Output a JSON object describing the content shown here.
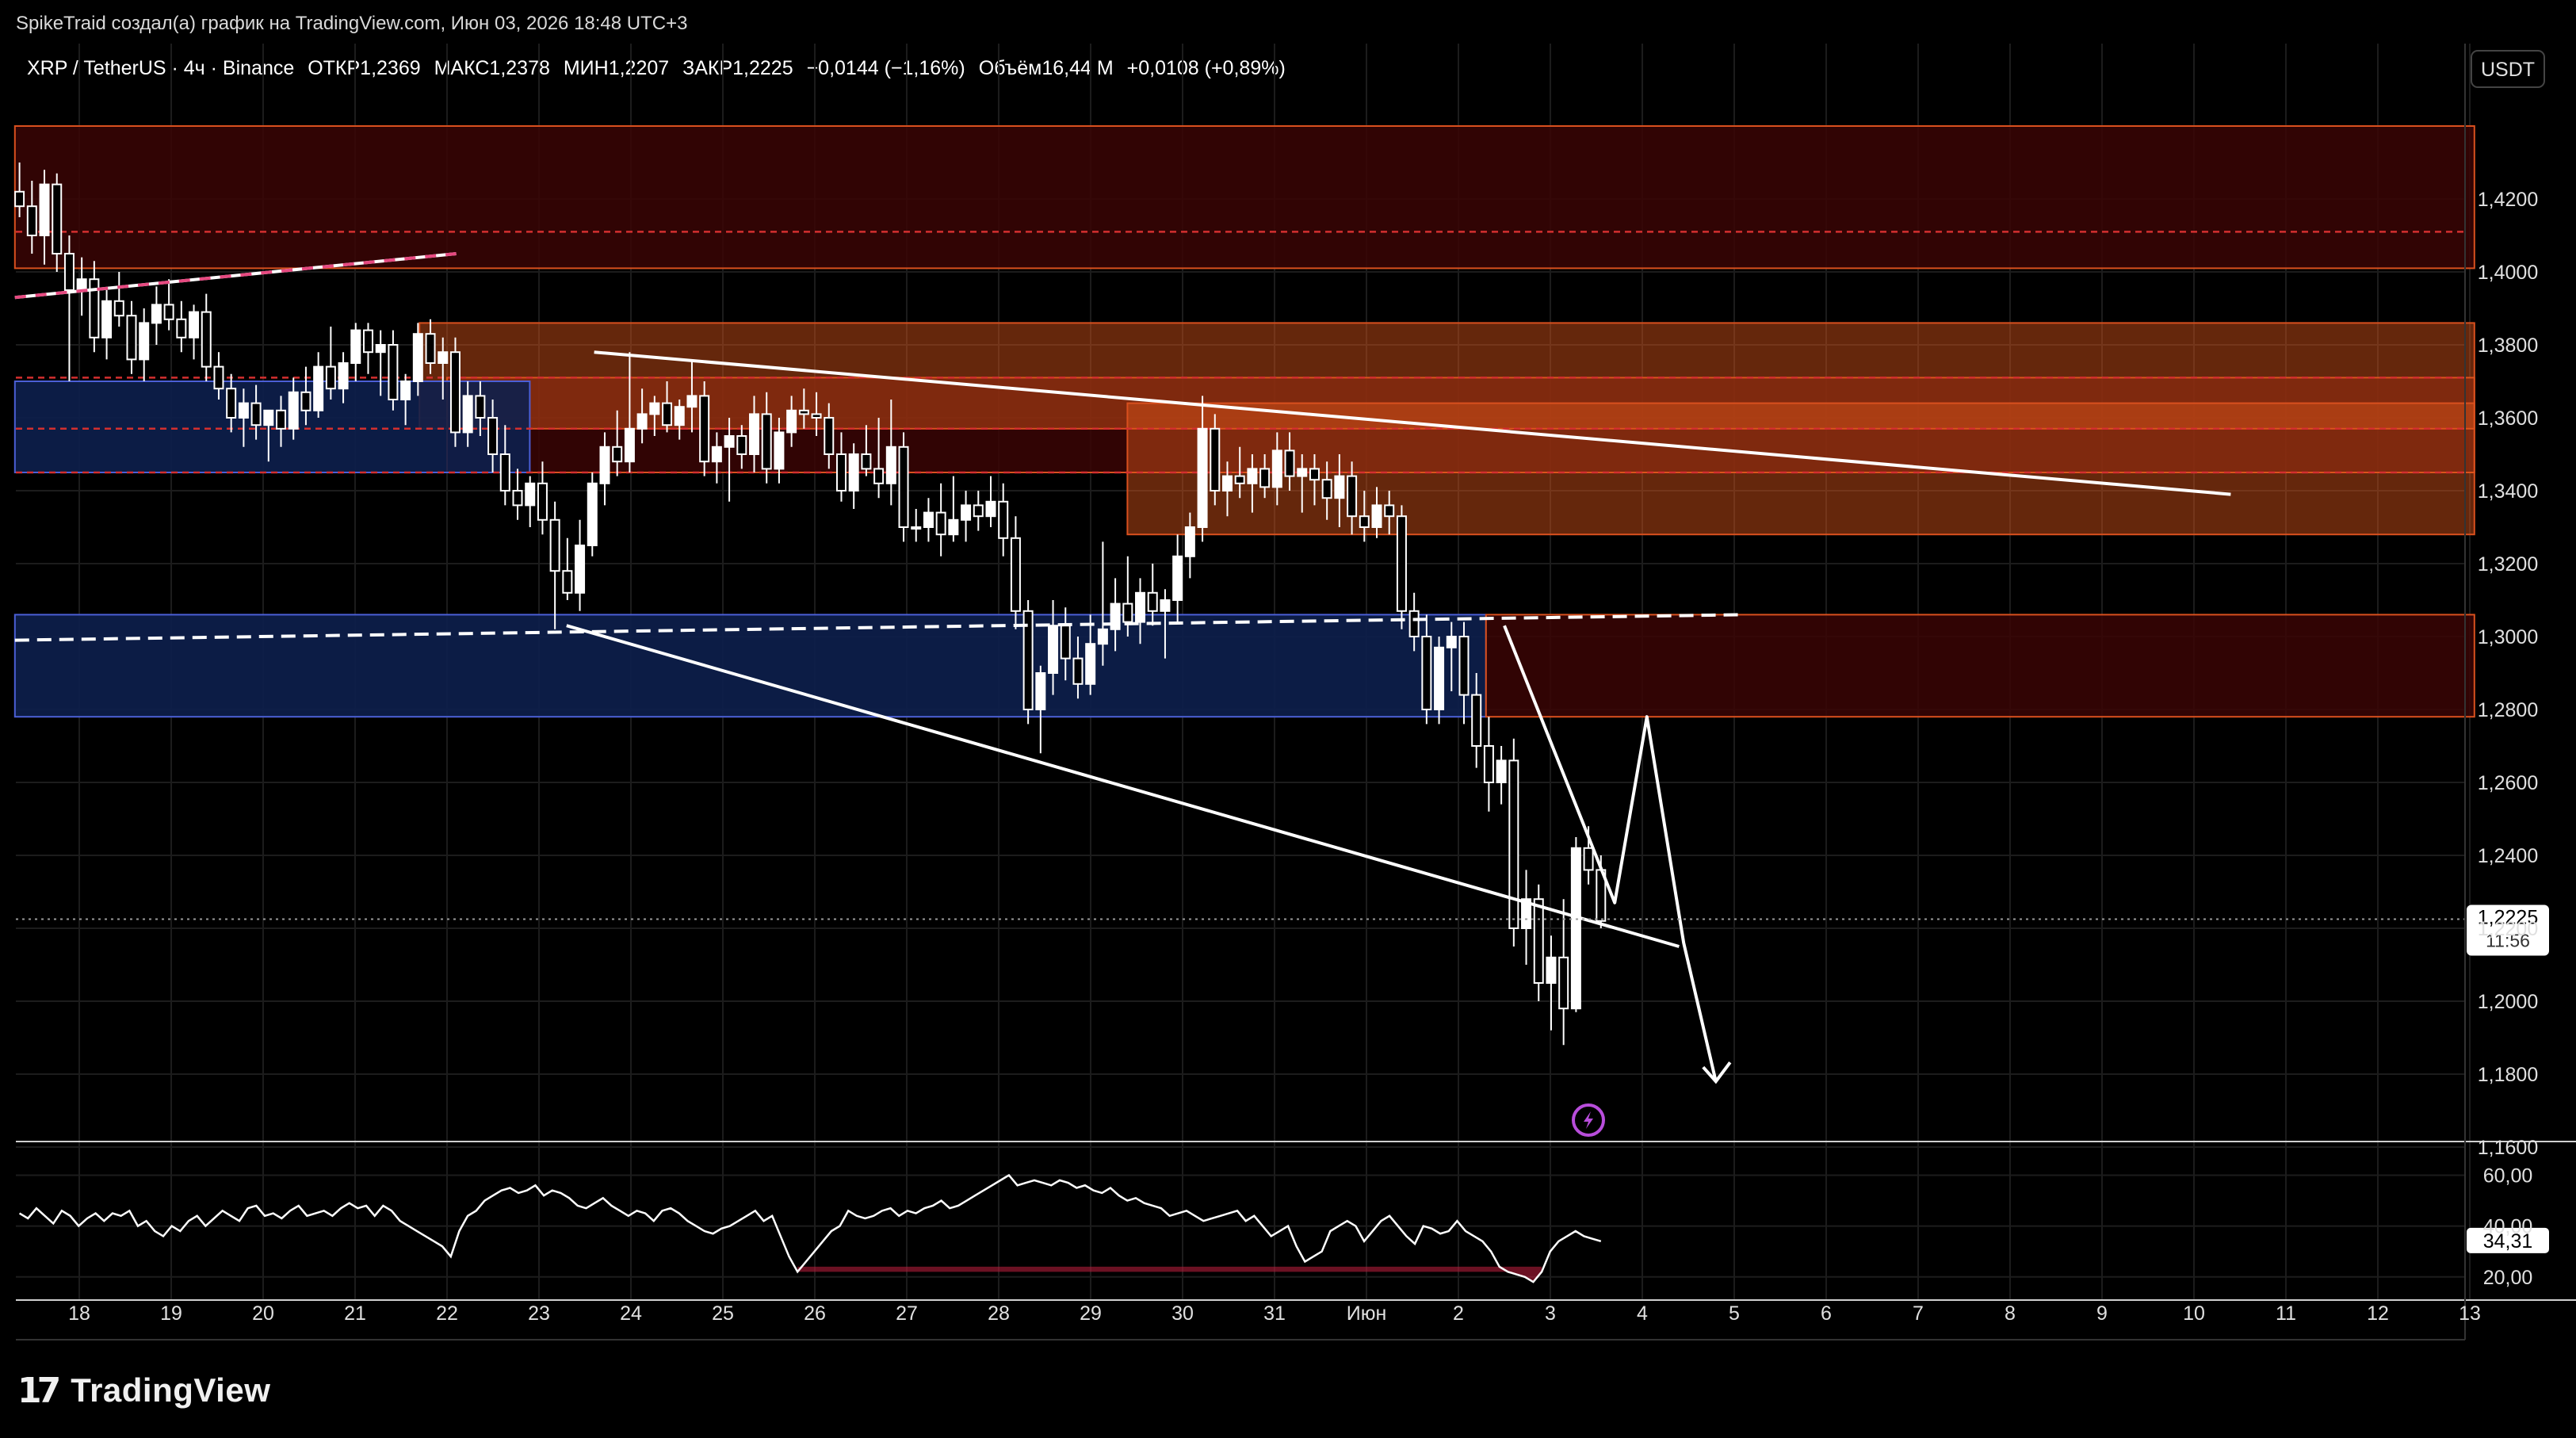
{
  "header": {
    "attribution": "SpikeTraid создал(а) график на TradingView.com, Июн 03, 2026 18:48 UTC+3"
  },
  "symbol_info": {
    "symbol": "XRP / TetherUS · 4ч · Binance",
    "open": "ОТКР1,2369",
    "high": "МАКС1,2378",
    "low": "МИН1,2207",
    "close": "ЗАКР1,2225",
    "change": "−0,0144 (−1,16%)",
    "volume": "Объём16,44 M",
    "volume_change": "+0,0108 (+0,89%)"
  },
  "currency": "USDT",
  "last_price": {
    "value": "1,2225",
    "countdown": "11:56",
    "level": 1.2225
  },
  "rsi_last": {
    "value": "34,31",
    "level": 34.31
  },
  "colors": {
    "background": "#000000",
    "grid": "#1c1c1c",
    "candle": "#ffffff",
    "zone_red": "#3a0505",
    "zone_orange": "#e0571a",
    "zone_blue": "#0d1f4d",
    "zone_blue_border": "#4b5fd6",
    "zone_red_border": "#d9501e",
    "dashed_red": "#d32f2f",
    "pink_line": "#e64980",
    "rsi_oversold": "#b31c3a",
    "alert_icon": "#b84ddb"
  },
  "branding": {
    "name": "TradingView",
    "logo_icon": "tradingview-logo-icon"
  },
  "alert_icon": "lightning-icon",
  "chart_data": [
    {
      "type": "candlestick",
      "pair": "XRP / TetherUS",
      "timeframe": "4ч",
      "ylim": [
        1.14,
        1.44
      ],
      "price_ticks": [
        "1,4200",
        "1,4000",
        "1,3800",
        "1,3600",
        "1,3400",
        "1,3200",
        "1,3000",
        "1,2800",
        "1,2600",
        "1,2400",
        "1,2200",
        "1,2000",
        "1,1800",
        "1,1600"
      ],
      "price_tick_values": [
        1.42,
        1.4,
        1.38,
        1.36,
        1.34,
        1.32,
        1.3,
        1.28,
        1.26,
        1.24,
        1.22,
        1.2,
        1.18,
        1.16
      ],
      "x_ticks": [
        "18",
        "19",
        "20",
        "21",
        "22",
        "23",
        "24",
        "25",
        "26",
        "27",
        "28",
        "29",
        "30",
        "31",
        "Июн",
        "2",
        "3",
        "4",
        "5",
        "6",
        "7",
        "8",
        "9",
        "10",
        "11",
        "12",
        "13"
      ],
      "x_range": [
        -0.7,
        26.05
      ],
      "grid": true,
      "zones": [
        {
          "kind": "red",
          "x0": -0.7,
          "x1": 26.05,
          "y0": 1.401,
          "y1": 1.44
        },
        {
          "kind": "red",
          "x0": 4.0,
          "x1": 26.05,
          "y0": 1.345,
          "y1": 1.371
        },
        {
          "kind": "orange",
          "x0": 3.7,
          "x1": 26.05,
          "y0": 1.357,
          "y1": 1.386
        },
        {
          "kind": "orange",
          "x0": 11.4,
          "x1": 26.05,
          "y0": 1.328,
          "y1": 1.364
        },
        {
          "kind": "blue",
          "x0": -0.7,
          "x1": 4.9,
          "y0": 1.345,
          "y1": 1.37
        },
        {
          "kind": "blue",
          "x0": -0.7,
          "x1": 15.3,
          "y0": 1.278,
          "y1": 1.306
        },
        {
          "kind": "red",
          "x0": 15.3,
          "x1": 26.05,
          "y0": 1.278,
          "y1": 1.306
        }
      ],
      "dashed_levels": [
        {
          "color": "red",
          "y": 1.411
        },
        {
          "color": "red",
          "y": 1.371
        },
        {
          "color": "red",
          "y": 1.357
        },
        {
          "color": "red",
          "y": 1.345
        }
      ],
      "trendlines": [
        {
          "style": "solid",
          "x0": 5.6,
          "y0": 1.378,
          "x1": 23.4,
          "y1": 1.339
        },
        {
          "style": "solid",
          "x0": 5.3,
          "y0": 1.303,
          "x1": 17.4,
          "y1": 1.215
        },
        {
          "style": "dashed",
          "x0": -0.7,
          "y0": 1.299,
          "x1": 18.1,
          "y1": 1.306
        },
        {
          "style": "solid",
          "x0": -0.7,
          "y0": 1.393,
          "x1": 4.1,
          "y1": 1.405
        },
        {
          "style": "pink-dashed",
          "x0": -0.7,
          "y0": 1.393,
          "x1": 4.1,
          "y1": 1.405
        }
      ],
      "projection_path": [
        [
          15.5,
          1.303
        ],
        [
          16.7,
          1.227
        ],
        [
          17.05,
          1.278
        ],
        [
          17.45,
          1.216
        ],
        [
          17.8,
          1.178
        ]
      ],
      "candles": [
        [
          1.422,
          1.43,
          1.415,
          1.418
        ],
        [
          1.418,
          1.425,
          1.405,
          1.41
        ],
        [
          1.41,
          1.428,
          1.402,
          1.424
        ],
        [
          1.424,
          1.427,
          1.4,
          1.405
        ],
        [
          1.405,
          1.41,
          1.37,
          1.395
        ],
        [
          1.395,
          1.404,
          1.388,
          1.398
        ],
        [
          1.398,
          1.403,
          1.378,
          1.382
        ],
        [
          1.382,
          1.395,
          1.376,
          1.392
        ],
        [
          1.392,
          1.4,
          1.385,
          1.388
        ],
        [
          1.388,
          1.392,
          1.372,
          1.376
        ],
        [
          1.376,
          1.39,
          1.37,
          1.386
        ],
        [
          1.386,
          1.396,
          1.38,
          1.391
        ],
        [
          1.391,
          1.398,
          1.384,
          1.387
        ],
        [
          1.387,
          1.392,
          1.378,
          1.382
        ],
        [
          1.382,
          1.391,
          1.376,
          1.389
        ],
        [
          1.389,
          1.394,
          1.37,
          1.374
        ],
        [
          1.374,
          1.378,
          1.365,
          1.368
        ],
        [
          1.368,
          1.372,
          1.356,
          1.36
        ],
        [
          1.36,
          1.368,
          1.352,
          1.364
        ],
        [
          1.364,
          1.369,
          1.354,
          1.358
        ],
        [
          1.358,
          1.362,
          1.348,
          1.362
        ],
        [
          1.362,
          1.366,
          1.352,
          1.357
        ],
        [
          1.357,
          1.371,
          1.354,
          1.367
        ],
        [
          1.367,
          1.374,
          1.358,
          1.362
        ],
        [
          1.362,
          1.378,
          1.36,
          1.374
        ],
        [
          1.374,
          1.385,
          1.365,
          1.368
        ],
        [
          1.368,
          1.378,
          1.364,
          1.375
        ],
        [
          1.375,
          1.386,
          1.37,
          1.384
        ],
        [
          1.384,
          1.386,
          1.372,
          1.378
        ],
        [
          1.378,
          1.384,
          1.366,
          1.38
        ],
        [
          1.38,
          1.384,
          1.362,
          1.365
        ],
        [
          1.365,
          1.372,
          1.358,
          1.37
        ],
        [
          1.37,
          1.386,
          1.366,
          1.383
        ],
        [
          1.383,
          1.387,
          1.372,
          1.375
        ],
        [
          1.375,
          1.382,
          1.365,
          1.378
        ],
        [
          1.378,
          1.382,
          1.352,
          1.356
        ],
        [
          1.356,
          1.37,
          1.352,
          1.366
        ],
        [
          1.366,
          1.37,
          1.355,
          1.36
        ],
        [
          1.36,
          1.365,
          1.345,
          1.35
        ],
        [
          1.35,
          1.358,
          1.336,
          1.34
        ],
        [
          1.34,
          1.346,
          1.332,
          1.336
        ],
        [
          1.336,
          1.344,
          1.33,
          1.342
        ],
        [
          1.342,
          1.348,
          1.328,
          1.332
        ],
        [
          1.332,
          1.337,
          1.302,
          1.318
        ],
        [
          1.318,
          1.327,
          1.31,
          1.312
        ],
        [
          1.312,
          1.332,
          1.307,
          1.325
        ],
        [
          1.325,
          1.345,
          1.322,
          1.342
        ],
        [
          1.342,
          1.356,
          1.336,
          1.352
        ],
        [
          1.352,
          1.362,
          1.344,
          1.348
        ],
        [
          1.348,
          1.378,
          1.345,
          1.357
        ],
        [
          1.357,
          1.368,
          1.353,
          1.361
        ],
        [
          1.361,
          1.366,
          1.355,
          1.364
        ],
        [
          1.364,
          1.37,
          1.356,
          1.358
        ],
        [
          1.358,
          1.365,
          1.354,
          1.363
        ],
        [
          1.363,
          1.376,
          1.356,
          1.366
        ],
        [
          1.366,
          1.37,
          1.344,
          1.348
        ],
        [
          1.348,
          1.356,
          1.342,
          1.352
        ],
        [
          1.352,
          1.36,
          1.337,
          1.355
        ],
        [
          1.355,
          1.358,
          1.346,
          1.35
        ],
        [
          1.35,
          1.366,
          1.345,
          1.361
        ],
        [
          1.361,
          1.367,
          1.342,
          1.346
        ],
        [
          1.346,
          1.36,
          1.342,
          1.356
        ],
        [
          1.356,
          1.366,
          1.352,
          1.362
        ],
        [
          1.362,
          1.368,
          1.357,
          1.361
        ],
        [
          1.361,
          1.367,
          1.355,
          1.36
        ],
        [
          1.36,
          1.364,
          1.346,
          1.35
        ],
        [
          1.35,
          1.356,
          1.337,
          1.34
        ],
        [
          1.34,
          1.353,
          1.335,
          1.35
        ],
        [
          1.35,
          1.358,
          1.344,
          1.346
        ],
        [
          1.346,
          1.36,
          1.338,
          1.342
        ],
        [
          1.342,
          1.365,
          1.336,
          1.352
        ],
        [
          1.352,
          1.356,
          1.326,
          1.33
        ],
        [
          1.33,
          1.335,
          1.326,
          1.33
        ],
        [
          1.33,
          1.338,
          1.326,
          1.334
        ],
        [
          1.334,
          1.342,
          1.322,
          1.328
        ],
        [
          1.328,
          1.344,
          1.326,
          1.332
        ],
        [
          1.332,
          1.34,
          1.326,
          1.336
        ],
        [
          1.336,
          1.34,
          1.329,
          1.333
        ],
        [
          1.333,
          1.344,
          1.33,
          1.337
        ],
        [
          1.337,
          1.342,
          1.322,
          1.327
        ],
        [
          1.327,
          1.333,
          1.302,
          1.307
        ],
        [
          1.307,
          1.31,
          1.276,
          1.28
        ],
        [
          1.28,
          1.292,
          1.268,
          1.29
        ],
        [
          1.29,
          1.31,
          1.284,
          1.303
        ],
        [
          1.303,
          1.308,
          1.288,
          1.294
        ],
        [
          1.294,
          1.3,
          1.283,
          1.287
        ],
        [
          1.287,
          1.306,
          1.284,
          1.298
        ],
        [
          1.298,
          1.326,
          1.292,
          1.302
        ],
        [
          1.302,
          1.316,
          1.296,
          1.309
        ],
        [
          1.309,
          1.322,
          1.3,
          1.304
        ],
        [
          1.304,
          1.316,
          1.298,
          1.312
        ],
        [
          1.312,
          1.32,
          1.303,
          1.307
        ],
        [
          1.307,
          1.313,
          1.294,
          1.31
        ],
        [
          1.31,
          1.328,
          1.304,
          1.322
        ],
        [
          1.322,
          1.334,
          1.316,
          1.33
        ],
        [
          1.33,
          1.366,
          1.326,
          1.357
        ],
        [
          1.357,
          1.361,
          1.336,
          1.34
        ],
        [
          1.34,
          1.348,
          1.333,
          1.344
        ],
        [
          1.344,
          1.352,
          1.338,
          1.342
        ],
        [
          1.342,
          1.35,
          1.334,
          1.346
        ],
        [
          1.346,
          1.35,
          1.338,
          1.341
        ],
        [
          1.341,
          1.356,
          1.336,
          1.351
        ],
        [
          1.351,
          1.356,
          1.34,
          1.344
        ],
        [
          1.344,
          1.35,
          1.334,
          1.346
        ],
        [
          1.346,
          1.35,
          1.336,
          1.343
        ],
        [
          1.343,
          1.348,
          1.332,
          1.338
        ],
        [
          1.338,
          1.35,
          1.33,
          1.344
        ],
        [
          1.344,
          1.348,
          1.328,
          1.333
        ],
        [
          1.333,
          1.34,
          1.326,
          1.33
        ],
        [
          1.33,
          1.341,
          1.327,
          1.336
        ],
        [
          1.336,
          1.34,
          1.328,
          1.333
        ],
        [
          1.333,
          1.336,
          1.302,
          1.307
        ],
        [
          1.307,
          1.312,
          1.296,
          1.3
        ],
        [
          1.3,
          1.306,
          1.276,
          1.28
        ],
        [
          1.28,
          1.3,
          1.276,
          1.297
        ],
        [
          1.297,
          1.304,
          1.285,
          1.3
        ],
        [
          1.3,
          1.304,
          1.276,
          1.284
        ],
        [
          1.284,
          1.29,
          1.264,
          1.27
        ],
        [
          1.27,
          1.278,
          1.252,
          1.26
        ],
        [
          1.26,
          1.27,
          1.254,
          1.266
        ],
        [
          1.266,
          1.272,
          1.215,
          1.22
        ],
        [
          1.22,
          1.236,
          1.21,
          1.228
        ],
        [
          1.228,
          1.232,
          1.2,
          1.205
        ],
        [
          1.205,
          1.218,
          1.192,
          1.212
        ],
        [
          1.212,
          1.228,
          1.188,
          1.198
        ],
        [
          1.198,
          1.245,
          1.197,
          1.242
        ],
        [
          1.242,
          1.248,
          1.232,
          1.236
        ],
        [
          1.236,
          1.24,
          1.22,
          1.222
        ]
      ]
    },
    {
      "type": "line",
      "name": "RSI",
      "ylim": [
        14,
        67
      ],
      "y_ticks": [
        "60,00",
        "40,00",
        "20,00"
      ],
      "y_tick_values": [
        60,
        40,
        20
      ],
      "values": [
        45,
        43,
        47,
        44,
        41,
        46,
        44,
        40,
        43,
        45,
        42,
        45,
        44,
        46,
        40,
        42,
        38,
        36,
        40,
        38,
        42,
        44,
        40,
        43,
        46,
        44,
        42,
        47,
        48,
        44,
        45,
        43,
        46,
        48,
        44,
        45,
        46,
        44,
        47,
        49,
        47,
        48,
        44,
        48,
        46,
        42,
        40,
        38,
        36,
        34,
        32,
        28,
        38,
        44,
        46,
        50,
        52,
        54,
        55,
        53,
        54,
        56,
        52,
        54,
        53,
        51,
        48,
        47,
        49,
        51,
        48,
        46,
        44,
        46,
        45,
        42,
        46,
        47,
        45,
        42,
        40,
        38,
        37,
        39,
        40,
        42,
        44,
        46,
        42,
        44,
        36,
        28,
        22,
        26,
        30,
        34,
        38,
        40,
        46,
        44,
        43,
        44,
        46,
        47,
        44,
        46,
        45,
        47,
        48,
        50,
        47,
        48,
        50,
        52,
        54,
        56,
        58,
        60,
        56,
        57,
        58,
        57,
        56,
        58,
        57,
        55,
        56,
        54,
        53,
        55,
        52,
        50,
        51,
        49,
        48,
        47,
        44,
        45,
        46,
        44,
        42,
        43,
        44,
        45,
        46,
        42,
        44,
        40,
        36,
        38,
        40,
        32,
        26,
        28,
        30,
        38,
        40,
        42,
        40,
        34,
        38,
        42,
        44,
        40,
        36,
        33,
        40,
        39,
        37,
        38,
        42,
        38,
        36,
        34,
        30,
        24,
        22,
        21,
        20,
        18,
        22,
        30,
        34,
        36,
        38,
        36,
        35,
        34
      ]
    }
  ]
}
